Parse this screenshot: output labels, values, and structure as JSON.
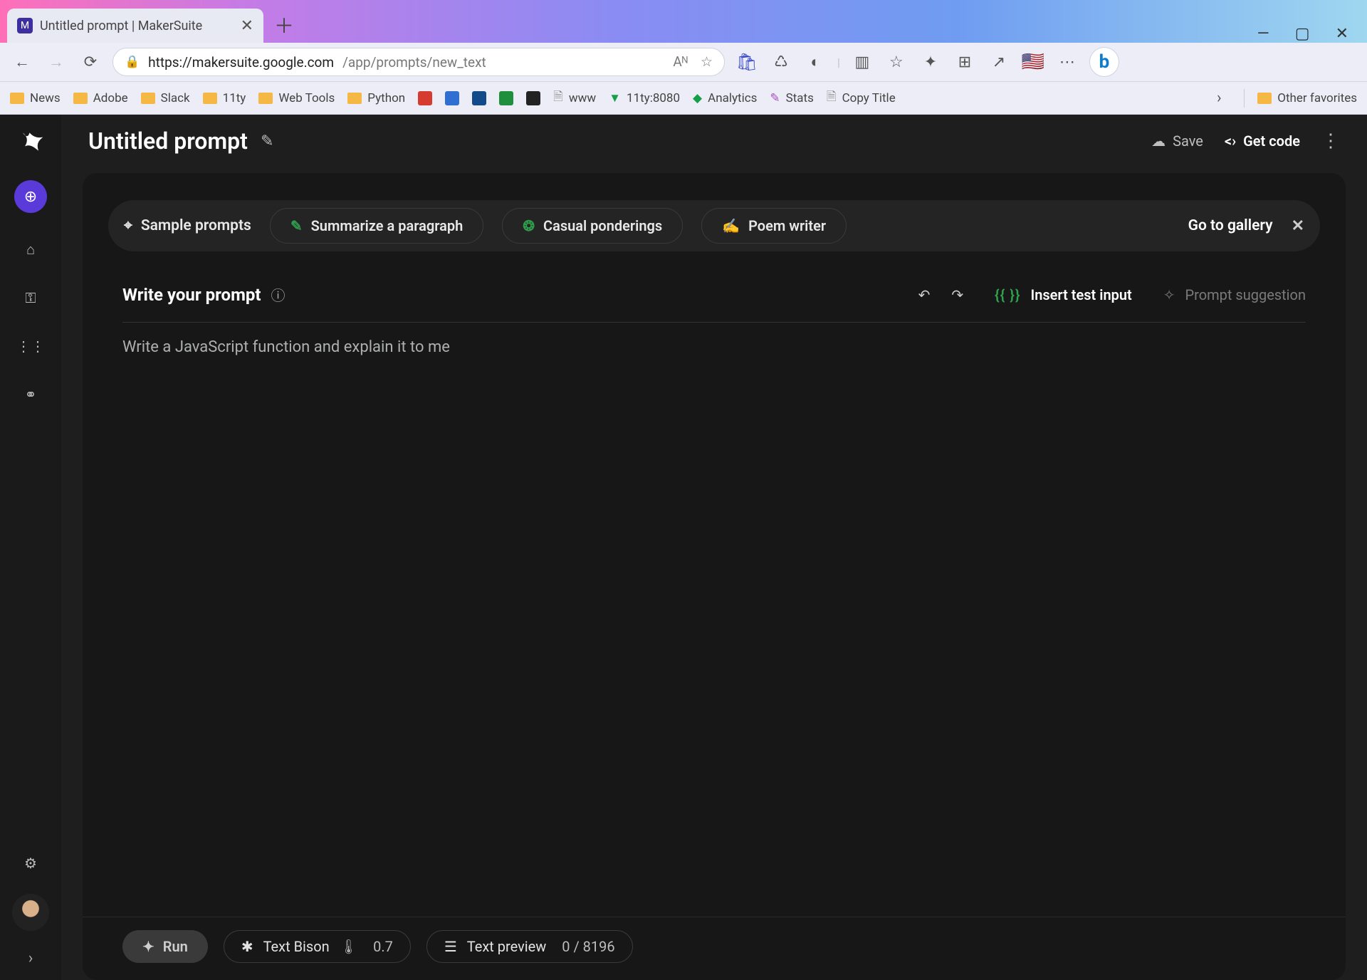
{
  "browser": {
    "tab_title": "Untitled prompt | MakerSuite",
    "url_host": "https://makersuite.google.com",
    "url_path": "/app/prompts/new_text",
    "window_controls": {
      "min": "—",
      "max": "▢",
      "close": "✕"
    },
    "toolbar_icons": [
      "A̋",
      "☆",
      "⛉",
      "♺",
      "☪",
      "|",
      "▥",
      "☆",
      "✦",
      "⊞",
      "↗",
      "🇺🇸",
      "⋯"
    ],
    "favorites_label": "Other favorites",
    "bookmarks": [
      {
        "label": "News",
        "type": "folder"
      },
      {
        "label": "Adobe",
        "type": "folder"
      },
      {
        "label": "Slack",
        "type": "folder"
      },
      {
        "label": "11ty",
        "type": "folder"
      },
      {
        "label": "Web Tools",
        "type": "folder"
      },
      {
        "label": "Python",
        "type": "folder"
      },
      {
        "label": "",
        "type": "icon",
        "color": "#d63b2f"
      },
      {
        "label": "",
        "type": "icon",
        "color": "#2e6fd1"
      },
      {
        "label": "",
        "type": "icon",
        "color": "#134b8a"
      },
      {
        "label": "",
        "type": "icon",
        "color": "#1f8f3d"
      },
      {
        "label": "",
        "type": "icon",
        "color": "#222"
      },
      {
        "label": "www",
        "type": "page"
      },
      {
        "label": "11ty:8080",
        "type": "page",
        "iconcolor": "#14a049"
      },
      {
        "label": "Analytics",
        "type": "page",
        "iconcolor": "#14a049"
      },
      {
        "label": "Stats",
        "type": "page",
        "iconcolor": "#7d3fb8"
      },
      {
        "label": "Copy Title",
        "type": "page"
      }
    ]
  },
  "rail": {
    "logo": "⋈"
  },
  "header": {
    "prompt_name": "Untitled prompt",
    "save_label": "Save",
    "get_code_label": "Get code"
  },
  "suggest": {
    "label": "Sample prompts",
    "pills": [
      "Summarize a paragraph",
      "Casual ponderings",
      "Poem writer"
    ],
    "gallery": "Go to gallery"
  },
  "prompt": {
    "title": "Write your prompt",
    "insert_label": "Insert test input",
    "suggestion_label": "Prompt suggestion",
    "content": "Write a JavaScript function and explain it to me"
  },
  "bottom": {
    "run": "Run",
    "model": "Text Bison",
    "temp": "0.7",
    "preview": "Text preview",
    "tokens": "0 / 8196"
  }
}
